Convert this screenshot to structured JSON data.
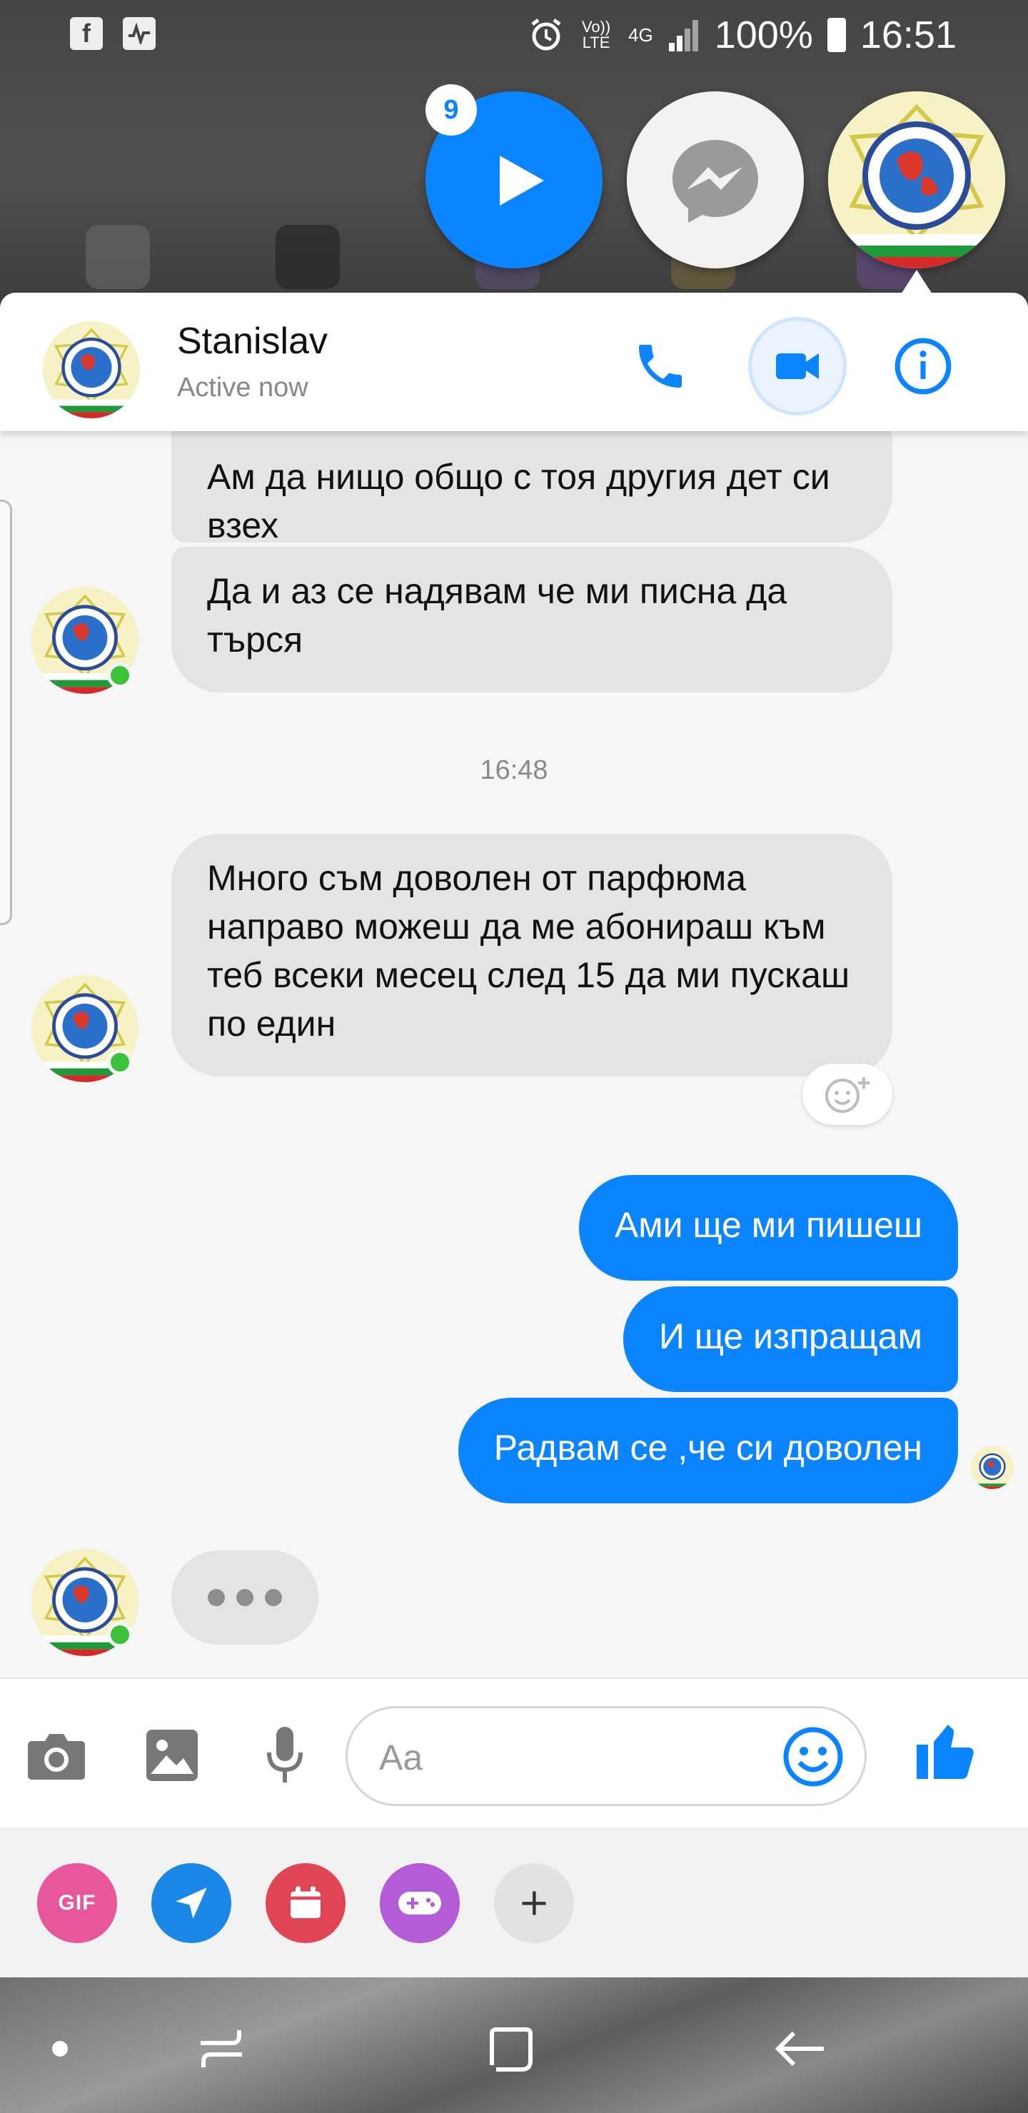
{
  "status_bar": {
    "left_icons": [
      "facebook-icon",
      "activity-icon"
    ],
    "volte_label": "Vo)) LTE",
    "network": "4G",
    "battery": "100%",
    "time": "16:51"
  },
  "chat_heads": {
    "badge_count": "9"
  },
  "header": {
    "name": "Stanislav",
    "status": "Active now",
    "actions": [
      "phone-icon",
      "video-camera-icon",
      "info-icon"
    ]
  },
  "messages": {
    "incoming_1": "Ам да нищо общо с тоя другия дет си взех",
    "incoming_2": "Да и аз се надявам че ми писна да търся",
    "timestamp": "16:48",
    "incoming_3": "Много съм доволен от парфюма направо можеш да ме абонираш към теб всеки месец след 15 да ми пускаш по един",
    "outgoing_1": "Ами ще ми пишеш",
    "outgoing_2": "И ще изпращам",
    "outgoing_3": "Радвам се ,че си доволен"
  },
  "composer": {
    "placeholder": "Aa",
    "icons": [
      "camera-icon",
      "image-icon",
      "microphone-icon",
      "emoji-icon",
      "thumbs-up-icon"
    ]
  },
  "quick_actions": {
    "gif_label": "GIF",
    "items": [
      "gif-icon",
      "location-icon",
      "calendar-icon",
      "game-icon",
      "plus-icon"
    ]
  },
  "colors": {
    "accent": "#0a84ff",
    "incoming_bubble": "#e4e4e4",
    "online": "#3cc13b"
  }
}
